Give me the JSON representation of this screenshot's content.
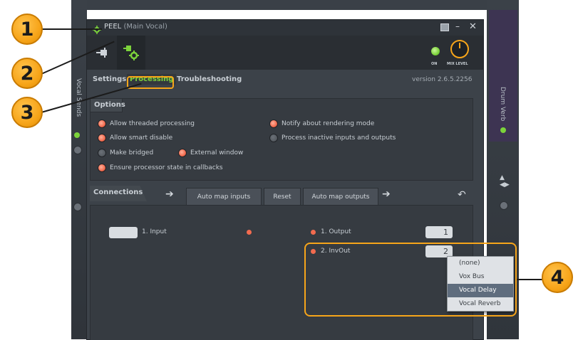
{
  "window": {
    "title": "PEEL",
    "subtitle": "(Main Vocal)"
  },
  "toolbar": {
    "on_label": "ON",
    "mix_label": "MIX LEVEL"
  },
  "tabs": [
    {
      "label": "Settings"
    },
    {
      "label": "Processing"
    },
    {
      "label": "Troubleshooting"
    }
  ],
  "version": "version 2.6.5.2256",
  "options": {
    "heading": "Options",
    "items": [
      {
        "label": "Allow threaded processing",
        "state": "on"
      },
      {
        "label": "Allow smart disable",
        "state": "on"
      },
      {
        "label": "Make bridged",
        "state": "off"
      },
      {
        "label": "External window",
        "state": "on"
      },
      {
        "label": "Ensure processor state in callbacks",
        "state": "on"
      },
      {
        "label": "Notify about rendering mode",
        "state": "on"
      },
      {
        "label": "Process inactive inputs and outputs",
        "state": "off"
      }
    ]
  },
  "connections": {
    "heading": "Connections",
    "auto_map_inputs": "Auto map inputs",
    "reset": "Reset",
    "auto_map_outputs": "Auto map outputs",
    "input_label": "1. Input",
    "outputs": [
      {
        "label": "1. Output",
        "value": "1"
      },
      {
        "label": "2. InvOut",
        "value": "2"
      }
    ]
  },
  "dropdown": {
    "options": [
      "(none)",
      "Vox Bus",
      "Vocal Delay",
      "Vocal Reverb"
    ],
    "selected": "Vocal Delay"
  },
  "side_strips": {
    "left_text": "Vocal Sends",
    "right_text": "Drum Verb"
  },
  "callouts": [
    "1",
    "2",
    "3",
    "4"
  ],
  "colors": {
    "accent_green": "#7cd33b",
    "led_orange": "#f26b4f",
    "highlight_orange": "#f7a51a",
    "window_bg": "#3c4249"
  }
}
